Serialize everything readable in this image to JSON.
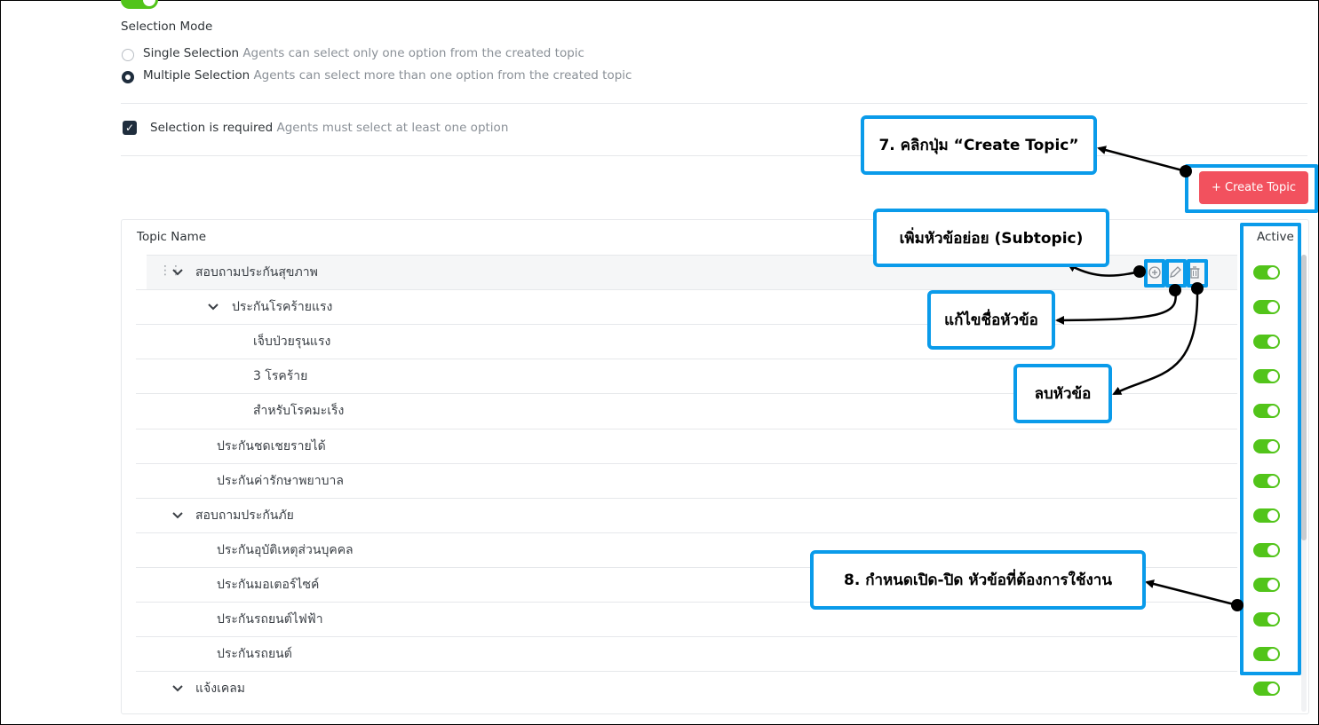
{
  "selection_mode": {
    "title": "Selection Mode",
    "options": [
      {
        "label": "Single Selection",
        "description": "Agents can select only one option from the created topic",
        "checked": false
      },
      {
        "label": "Multiple Selection",
        "description": "Agents can select more than one option from the created topic",
        "checked": true
      }
    ]
  },
  "required": {
    "label": "Selection is required",
    "description": "Agents must select at least one option",
    "checked": true
  },
  "create_button": {
    "label": "+ Create Topic"
  },
  "table": {
    "header_topic": "Topic Name",
    "header_active": "Active",
    "rows": [
      {
        "name": "สอบถามประกันสุขภาพ",
        "level": 0,
        "expandable": true,
        "active": true
      },
      {
        "name": "ประกันโรคร้ายแรง",
        "level": 1,
        "expandable": true,
        "active": true
      },
      {
        "name": "เจ็บป่วยรุนแรง",
        "level": 2,
        "expandable": false,
        "active": true
      },
      {
        "name": "3 โรคร้าย",
        "level": 2,
        "expandable": false,
        "active": true
      },
      {
        "name": "สำหรับโรคมะเร็ง",
        "level": 2,
        "expandable": false,
        "active": true
      },
      {
        "name": "ประกันชดเชยรายได้",
        "level": 1,
        "expandable": false,
        "active": true
      },
      {
        "name": "ประกันค่ารักษาพยาบาล",
        "level": 1,
        "expandable": false,
        "active": true
      },
      {
        "name": "สอบถามประกันภัย",
        "level": 0,
        "expandable": true,
        "active": true
      },
      {
        "name": "ประกันอุบัติเหตุส่วนบุคคล",
        "level": 1,
        "expandable": false,
        "active": true
      },
      {
        "name": "ประกันมอเตอร์ไซค์",
        "level": 1,
        "expandable": false,
        "active": true
      },
      {
        "name": "ประกันรถยนต์ไฟฟ้า",
        "level": 1,
        "expandable": false,
        "active": true
      },
      {
        "name": "ประกันรถยนต์",
        "level": 1,
        "expandable": false,
        "active": true
      },
      {
        "name": "แจ้งเคลม",
        "level": 0,
        "expandable": true,
        "active": true
      }
    ]
  },
  "callouts": {
    "create_topic": "7. คลิกปุ่ม “Create Topic”",
    "add_subtopic": "เพิ่มหัวข้อย่อย (Subtopic)",
    "edit_name": "แก้ไขชื่อหัวข้อ",
    "delete_topic": "ลบหัวข้อ",
    "toggle_active": "8. กำหนดเปิด-ปิด หัวข้อที่ต้องการใช้งาน"
  },
  "colors": {
    "accent": "#0a9bea",
    "create_button": "#f2515e",
    "toggle_on": "#52c41a"
  }
}
